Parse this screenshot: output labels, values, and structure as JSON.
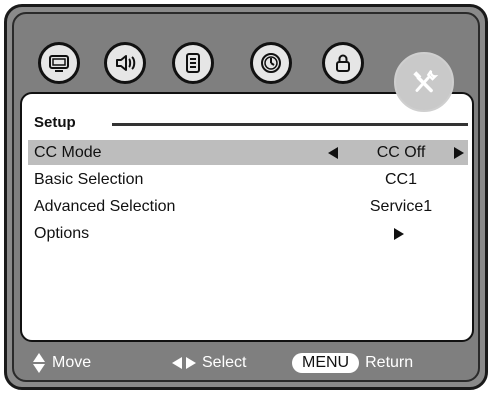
{
  "icons": [
    {
      "name": "picture-icon",
      "active": false
    },
    {
      "name": "audio-icon",
      "active": false
    },
    {
      "name": "document-icon",
      "active": false
    },
    {
      "name": "clock-icon",
      "active": false
    },
    {
      "name": "lock-icon",
      "active": false
    },
    {
      "name": "setup-wrench-icon",
      "active": true
    }
  ],
  "panel": {
    "title": "Setup",
    "rows": [
      {
        "label": "CC Mode",
        "value": "CC Off",
        "selected": true
      },
      {
        "label": "Basic Selection",
        "value": "CC1",
        "selected": false
      },
      {
        "label": "Advanced Selection",
        "value": "Service1",
        "selected": false
      },
      {
        "label": "Options",
        "value": "",
        "selected": false
      }
    ]
  },
  "footer": {
    "move_label": "Move",
    "select_label": "Select",
    "menu_key": "MENU",
    "return_label": "Return"
  }
}
